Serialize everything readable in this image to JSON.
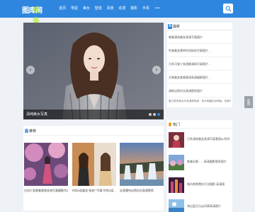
{
  "header": {
    "logo_main": "图库网",
    "logo_sub": "头条",
    "nav": [
      "首页",
      "明星",
      "美女",
      "壁纸",
      "风景",
      "动漫",
      "摄影",
      "手机"
    ],
    "more_label": "•••",
    "search_icon": "search-icon"
  },
  "slider": {
    "caption": "清纯美女写真",
    "prev_icon": "chevron-left-icon",
    "next_icon": "chevron-right-icon",
    "dots": [
      0,
      1,
      2
    ],
    "active_dot": 2
  },
  "latest": {
    "icon_letter": "N",
    "title": "最新",
    "items": [
      "唯美清纯美女高清写真图片",
      "性感美女模特时尚街拍写真图片...",
      "日系可爱少女甜美清新写真图片...",
      "古装美女唯美意境高清摄影图片...",
      "清新自然风光高清壁纸图片"
    ],
    "long_text": "春日里的美女写真清新唯美，阳光明媚自然清爽，甜美可人的笑容让人心动不已更多精彩"
  },
  "recommend": {
    "title": "推荐",
    "cards": [
      {
        "title": "古风少女唯美意境花海写真摄影作品图片"
      },
      {
        "title": "时尚4组美女\"街拍\"\"写真\"时尚4组..."
      },
      {
        "title": "壮观瀑布自然风光高清壁纸"
      }
    ]
  },
  "hot": {
    "title": "热门",
    "items": [
      "日系清纯美女高清写真套图dc系列",
      "唯美风景.......高清摄影壁纸图片",
      "城市夜景霓虹灯光摄影 高清图",
      "海边蓝天白云风景高清图片"
    ]
  },
  "side_tab": {
    "label": "反馈"
  },
  "colors": {
    "accent": "#2e86de",
    "background": "#eef1f5"
  }
}
